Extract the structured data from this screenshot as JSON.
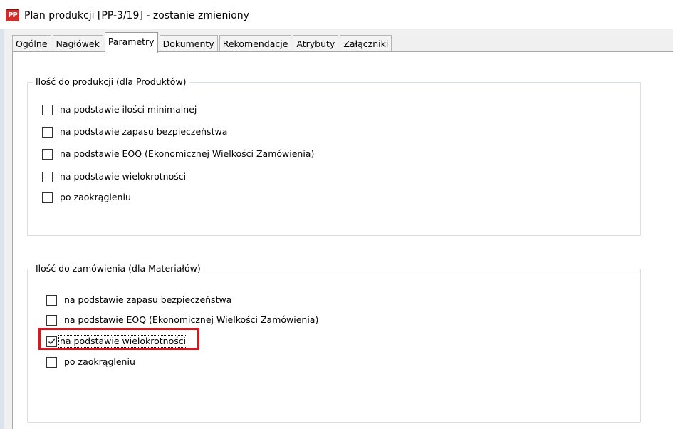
{
  "window": {
    "icon_label": "PP",
    "title": "Plan produkcji [PP-3/19] - zostanie zmieniony"
  },
  "tabs": [
    {
      "label": "Ogólne",
      "active": false
    },
    {
      "label": "Nagłówek",
      "active": false
    },
    {
      "label": "Parametry",
      "active": true
    },
    {
      "label": "Dokumenty",
      "active": false
    },
    {
      "label": "Rekomendacje",
      "active": false
    },
    {
      "label": "Atrybuty",
      "active": false
    },
    {
      "label": "Załączniki",
      "active": false
    }
  ],
  "group_products": {
    "legend": "Ilość do produkcji (dla Produktów)",
    "options": [
      {
        "label": "na podstawie ilości minimalnej",
        "checked": false
      },
      {
        "label": "na podstawie zapasu bezpieczeństwa",
        "checked": false
      },
      {
        "label": "na podstawie EOQ (Ekonomicznej Wielkości Zamówienia)",
        "checked": false
      },
      {
        "label": "na podstawie wielokrotności",
        "checked": false
      },
      {
        "label": "po zaokrągleniu",
        "checked": false
      }
    ]
  },
  "group_materials": {
    "legend": "Ilość do zamówienia (dla Materiałów)",
    "options": [
      {
        "label": "na podstawie zapasu bezpieczeństwa",
        "checked": false
      },
      {
        "label": "na podstawie EOQ (Ekonomicznej Wielkości Zamówienia)",
        "checked": false
      },
      {
        "label": "na podstawie wielokrotności",
        "checked": true
      },
      {
        "label": "po zaokrągleniu",
        "checked": false
      }
    ]
  },
  "colors": {
    "highlight": "#e0141c",
    "icon_red": "#d42b2b",
    "group_border": "#d5dfe5"
  }
}
